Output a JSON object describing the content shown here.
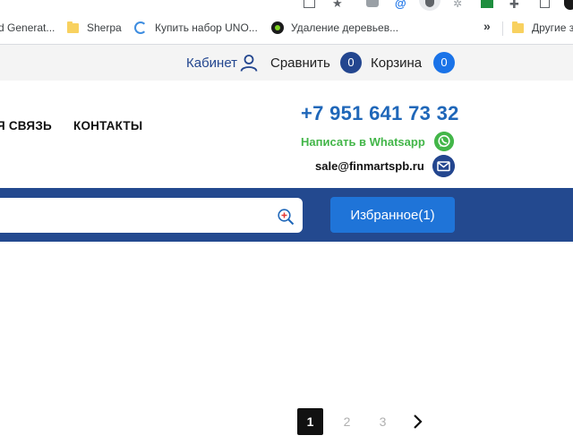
{
  "browser": {
    "bookmarks": [
      {
        "label": "d Generat...",
        "icon": "folder-icon"
      },
      {
        "label": "Sherpa",
        "icon": "folder-icon"
      },
      {
        "label": "Купить набор UNO...",
        "icon": "loading-icon"
      },
      {
        "label": "Удаление деревьев...",
        "icon": "site-favicon"
      }
    ],
    "more_glyph": "»",
    "other_bookmarks": "Другие з"
  },
  "top_bar": {
    "cabinet_label": "Кабинет",
    "compare_label": "Сравнить",
    "compare_count": "0",
    "cart_label": "Корзина",
    "cart_count": "0"
  },
  "nav": {
    "items": [
      "Я СВЯЗЬ",
      "КОНТАКТЫ"
    ]
  },
  "contacts": {
    "phone": "+7 951 641 73 32",
    "whatsapp_label": "Написать в Whatsapp",
    "email": "sale@finmartspb.ru"
  },
  "search": {
    "value": "",
    "placeholder": ""
  },
  "favorites_button": "Избранное(1)",
  "pagination": {
    "pages": [
      "1",
      "2",
      "3"
    ],
    "current": "1",
    "next_glyph": "›"
  },
  "colors": {
    "brand_blue": "#23498f",
    "accent_blue": "#1f74d8",
    "phone_blue": "#1f67b9",
    "whatsapp_green": "#43b649"
  }
}
